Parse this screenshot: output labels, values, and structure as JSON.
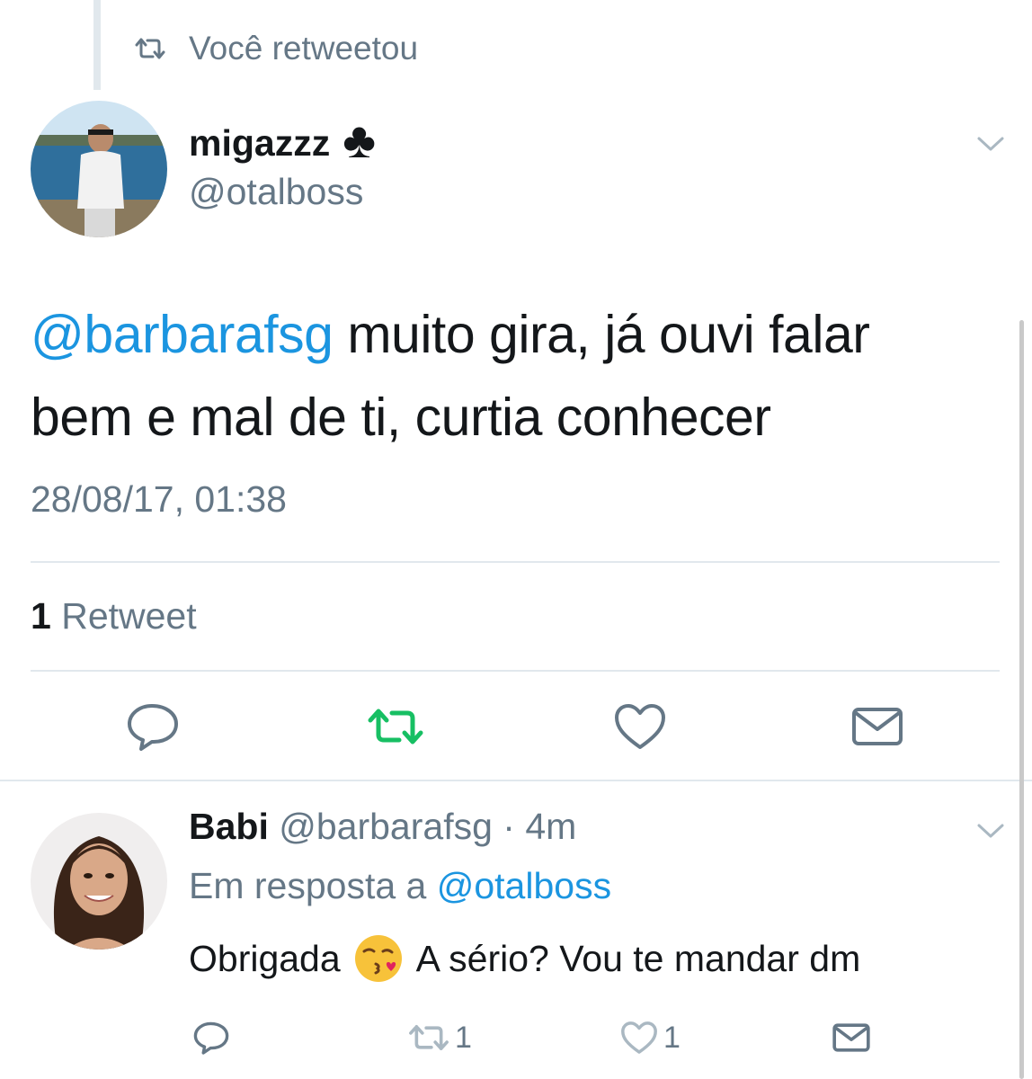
{
  "context": {
    "label": "Você retweetou"
  },
  "tweet": {
    "author_name": "migazzz",
    "author_suffix": "♣",
    "author_handle": "@otalboss",
    "mention": "@barbarafsg",
    "text_line1": " muito gira, já ouvi falar",
    "text_line2": "bem e mal de ti, curtia conhecer",
    "timestamp": "28/08/17, 01:38",
    "retweet_count": "1",
    "retweet_label": " Retweet"
  },
  "reply": {
    "name": "Babi",
    "handle": " @barbarafsg",
    "time": " · 4m",
    "in_reply_prefix": "Em resposta a ",
    "in_reply_handle": "@otalboss",
    "text_before": "Obrigada",
    "text_after": "A sério? Vou te mandar dm",
    "retweet_count": "1",
    "like_count": "1"
  },
  "colors": {
    "accent": "#1b95e0",
    "retweet_green": "#17bf63",
    "muted": "#657786",
    "divider": "#e1e8ed"
  },
  "icons": [
    "retweet-icon",
    "chevron-down-icon",
    "reply-icon",
    "like-icon",
    "message-icon",
    "kiss-emoji-icon"
  ]
}
